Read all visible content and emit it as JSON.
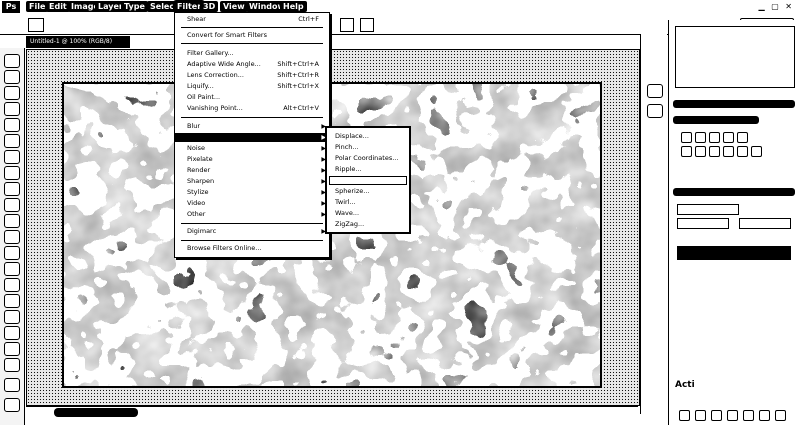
{
  "menubar": {
    "logo": "Ps",
    "items": [
      "File",
      "Edit",
      "Image",
      "Layer",
      "Type",
      "Select",
      "Filter",
      "3D",
      "View",
      "Window",
      "Help"
    ],
    "active": "Filter"
  },
  "filter_menu": {
    "items": [
      {
        "label": "Shear",
        "shortcut": "Ctrl+F"
      },
      {
        "label": "Convert for Smart Filters",
        "shortcut": ""
      },
      {
        "label": "Filter Gallery...",
        "shortcut": ""
      },
      {
        "label": "Adaptive Wide Angle...",
        "shortcut": "Shift+Ctrl+A"
      },
      {
        "label": "Lens Correction...",
        "shortcut": "Shift+Ctrl+R"
      },
      {
        "label": "Liquify...",
        "shortcut": "Shift+Ctrl+X"
      },
      {
        "label": "Oil Paint...",
        "shortcut": ""
      },
      {
        "label": "Vanishing Point...",
        "shortcut": "Alt+Ctrl+V"
      },
      {
        "label": "Blur",
        "shortcut": ""
      },
      {
        "label": "",
        "shortcut": ""
      },
      {
        "label": "Noise",
        "shortcut": ""
      },
      {
        "label": "Pixelate",
        "shortcut": ""
      },
      {
        "label": "Render",
        "shortcut": ""
      },
      {
        "label": "Sharpen",
        "shortcut": ""
      },
      {
        "label": "Stylize",
        "shortcut": ""
      },
      {
        "label": "Video",
        "shortcut": ""
      },
      {
        "label": "Other",
        "shortcut": ""
      },
      {
        "label": "Digimarc",
        "shortcut": ""
      },
      {
        "label": "Browse Filters Online...",
        "shortcut": ""
      }
    ]
  },
  "distort_submenu": {
    "items": [
      "Displace...",
      "Pinch...",
      "Polar Coordinates...",
      "Ripple...",
      "",
      "Spherize...",
      "Twirl...",
      "Wave...",
      "ZigZag..."
    ]
  },
  "document": {
    "tab_label": "Untitled-1 @ 100% (RGB/8)",
    "zoom": "100%"
  },
  "watermark": "Acti"
}
